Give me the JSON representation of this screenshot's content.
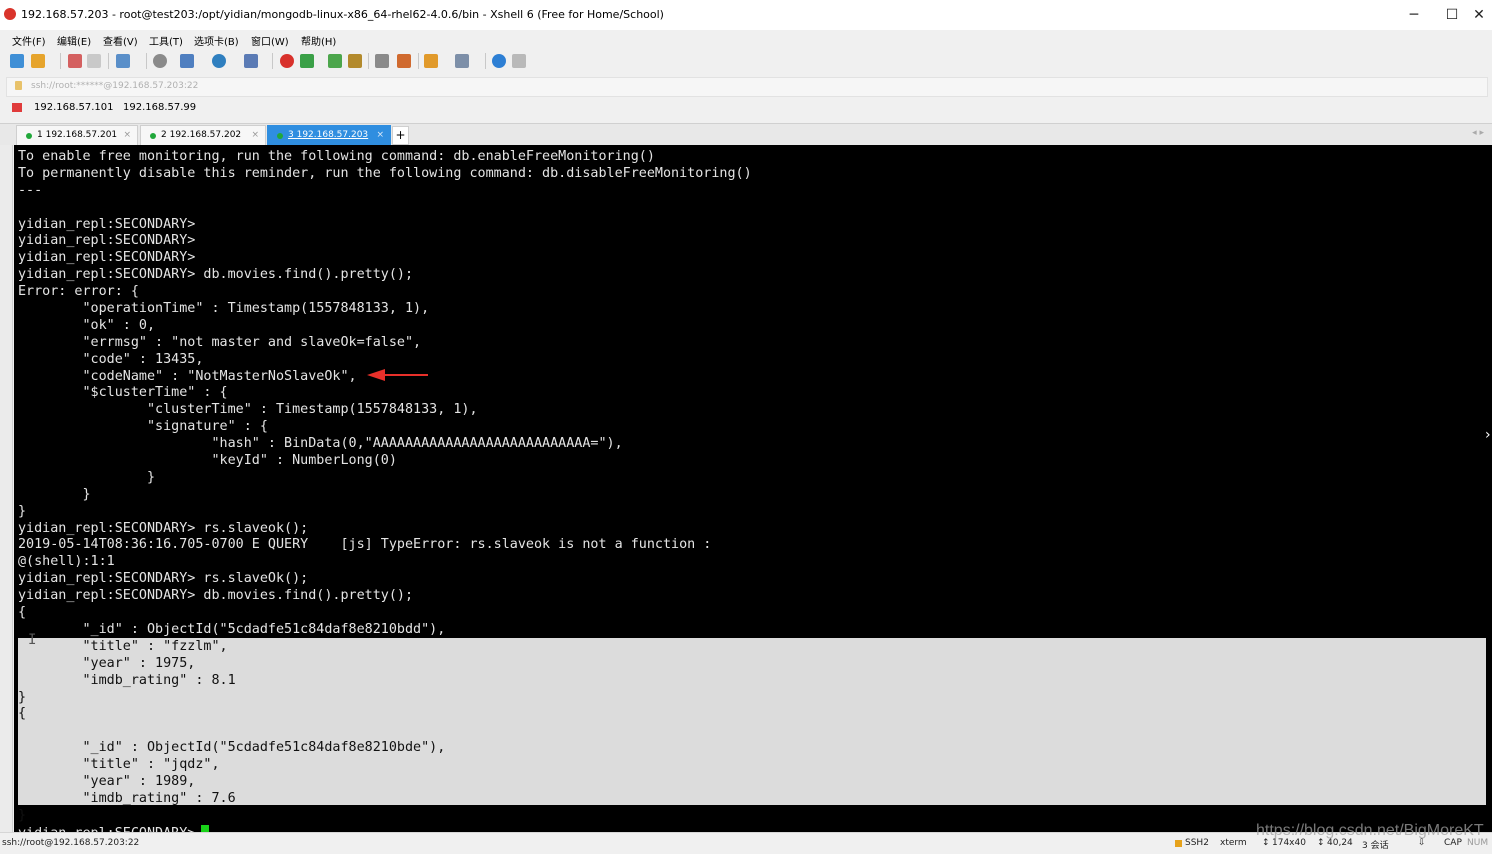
{
  "window": {
    "title": "192.168.57.203 - root@test203:/opt/yidian/mongodb-linux-x86_64-rhel62-4.0.6/bin - Xshell 6 (Free for Home/School)",
    "minimize_glyph": "─",
    "maximize_glyph": "☐",
    "close_glyph": "✕"
  },
  "menu": [
    "文件(F)",
    "编辑(E)",
    "查看(V)",
    "工具(T)",
    "选项卡(B)",
    "窗口(W)",
    "帮助(H)"
  ],
  "address": "ssh://root:******@192.168.57.203:22",
  "links": [
    "192.168.57.101",
    "192.168.57.99"
  ],
  "tabs": [
    {
      "label": "1 192.168.57.201",
      "close": "×",
      "active": false
    },
    {
      "label": "2 192.168.57.202",
      "close": "×",
      "active": false
    },
    {
      "label": "3 192.168.57.203",
      "close": "×",
      "active": true
    }
  ],
  "new_tab": "+",
  "tab_nav": "◂ ▸",
  "terminal": {
    "lines": [
      "To enable free monitoring, run the following command: db.enableFreeMonitoring()",
      "To permanently disable this reminder, run the following command: db.disableFreeMonitoring()",
      "---",
      "",
      "yidian_repl:SECONDARY>",
      "yidian_repl:SECONDARY>",
      "yidian_repl:SECONDARY>",
      "yidian_repl:SECONDARY> db.movies.find().pretty();",
      "Error: error: {",
      "        \"operationTime\" : Timestamp(1557848133, 1),",
      "        \"ok\" : 0,",
      "        \"errmsg\" : \"not master and slaveOk=false\",",
      "        \"code\" : 13435,",
      "        \"codeName\" : \"NotMasterNoSlaveOk\",",
      "        \"$clusterTime\" : {",
      "                \"clusterTime\" : Timestamp(1557848133, 1),",
      "                \"signature\" : {",
      "                        \"hash\" : BinData(0,\"AAAAAAAAAAAAAAAAAAAAAAAAAAA=\"),",
      "                        \"keyId\" : NumberLong(0)",
      "                }",
      "        }",
      "}",
      "yidian_repl:SECONDARY> rs.slaveok();",
      "2019-05-14T08:36:16.705-0700 E QUERY    [js] TypeError: rs.slaveok is not a function :",
      "@(shell):1:1",
      "yidian_repl:SECONDARY> rs.slaveOk();",
      "yidian_repl:SECONDARY> db.movies.find().pretty();",
      "{",
      "        \"_id\" : ObjectId(\"5cdadfe51c84daf8e8210bdd\"),",
      "        \"title\" : \"fzzlm\",",
      "        \"year\" : 1975,",
      "        \"imdb_rating\" : 8.1",
      "}",
      "{",
      "",
      "        \"_id\" : ObjectId(\"5cdadfe51c84daf8e8210bde\"),",
      "        \"title\" : \"jqdz\",",
      "        \"year\" : 1989,",
      "        \"imdb_rating\" : 7.6",
      "}",
      "yidian_repl:SECONDARY>"
    ],
    "selected_lines": [
      29,
      30,
      31,
      32,
      33,
      34,
      35,
      36,
      37,
      38,
      39
    ],
    "annotated_line": 13,
    "annotation_color": "#e8302a",
    "cursor_color": "#19d219"
  },
  "status": {
    "session": "ssh://root@192.168.57.203:22",
    "protocol": "SSH2",
    "term": "xterm",
    "size": "174x40",
    "cursor_pos": "40,24",
    "sessions": "3 会话",
    "caps": "CAP",
    "num": "NUM"
  },
  "watermark": "https://blog.csdn.net/BigMoreKT"
}
